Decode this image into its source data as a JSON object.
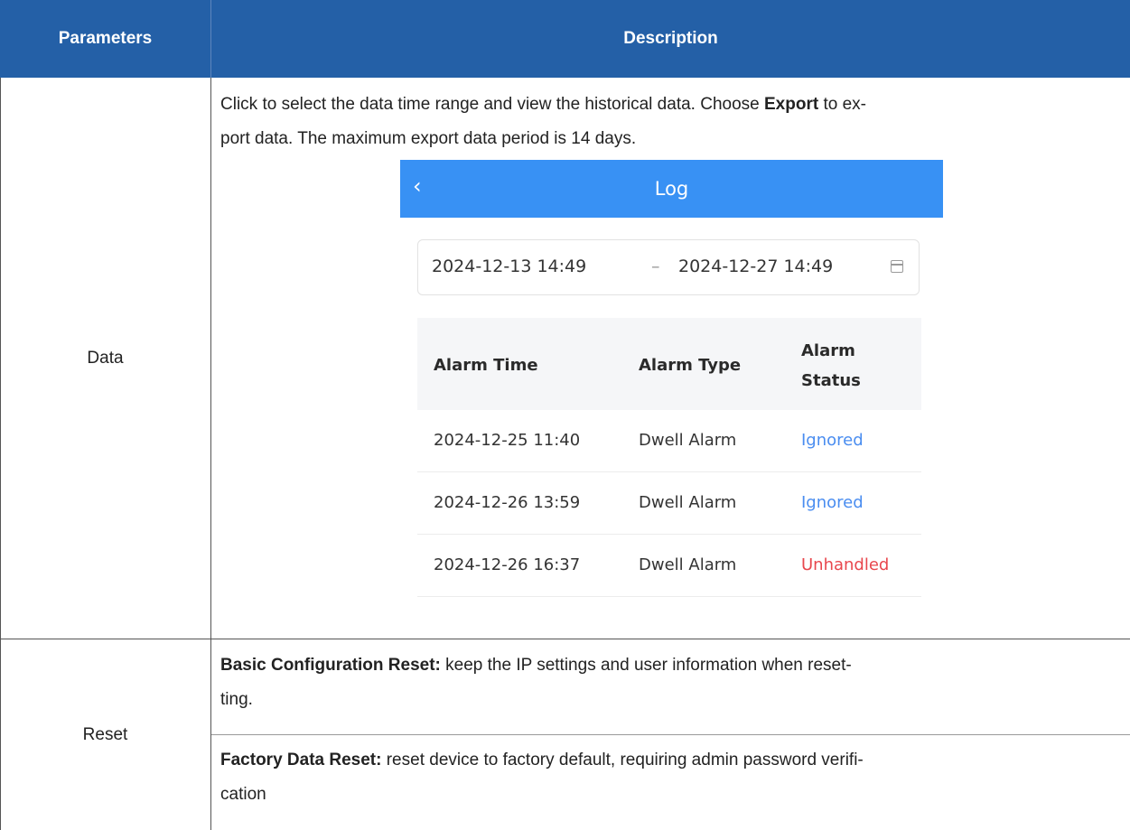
{
  "table": {
    "headers": {
      "parameters": "Parameters",
      "description": "Description"
    },
    "rows": [
      {
        "parameter": "Data",
        "description_part1": "Click to select the data time range and view the historical data. Choose ",
        "description_bold": "Export",
        "description_part2": " to ex-",
        "description_line2": "port data. The maximum export data period is 14 days."
      },
      {
        "parameter": "Reset",
        "items": [
          {
            "bold": "Basic Configuration Reset:",
            "text": " keep the IP settings and user information when reset-",
            "text_line2": "ting."
          },
          {
            "bold": "Factory Data Reset:",
            "text": " reset device to factory default, requiring admin password verifi-",
            "text_line2": "cation"
          }
        ]
      }
    ]
  },
  "app": {
    "title": "Log",
    "back_icon": "chevron-left-icon",
    "date_range": {
      "start": "2024-12-13 14:49",
      "separator": "–",
      "end": "2024-12-27 14:49",
      "icon": "calendar-icon"
    },
    "log_table": {
      "columns": [
        "Alarm Time",
        "Alarm Type",
        "Alarm",
        "Status"
      ],
      "rows": [
        {
          "time": "2024-12-25 11:40",
          "type": "Dwell Alarm",
          "status": "Ignored"
        },
        {
          "time": "2024-12-26 13:59",
          "type": "Dwell Alarm",
          "status": "Ignored"
        },
        {
          "time": "2024-12-26 16:37",
          "type": "Dwell Alarm",
          "status": "Unhandled"
        }
      ]
    },
    "colors": {
      "header_bg": "#2460a7",
      "app_bar": "#3891f4",
      "ignored": "#4a8df0",
      "unhandled": "#e8474d"
    }
  }
}
